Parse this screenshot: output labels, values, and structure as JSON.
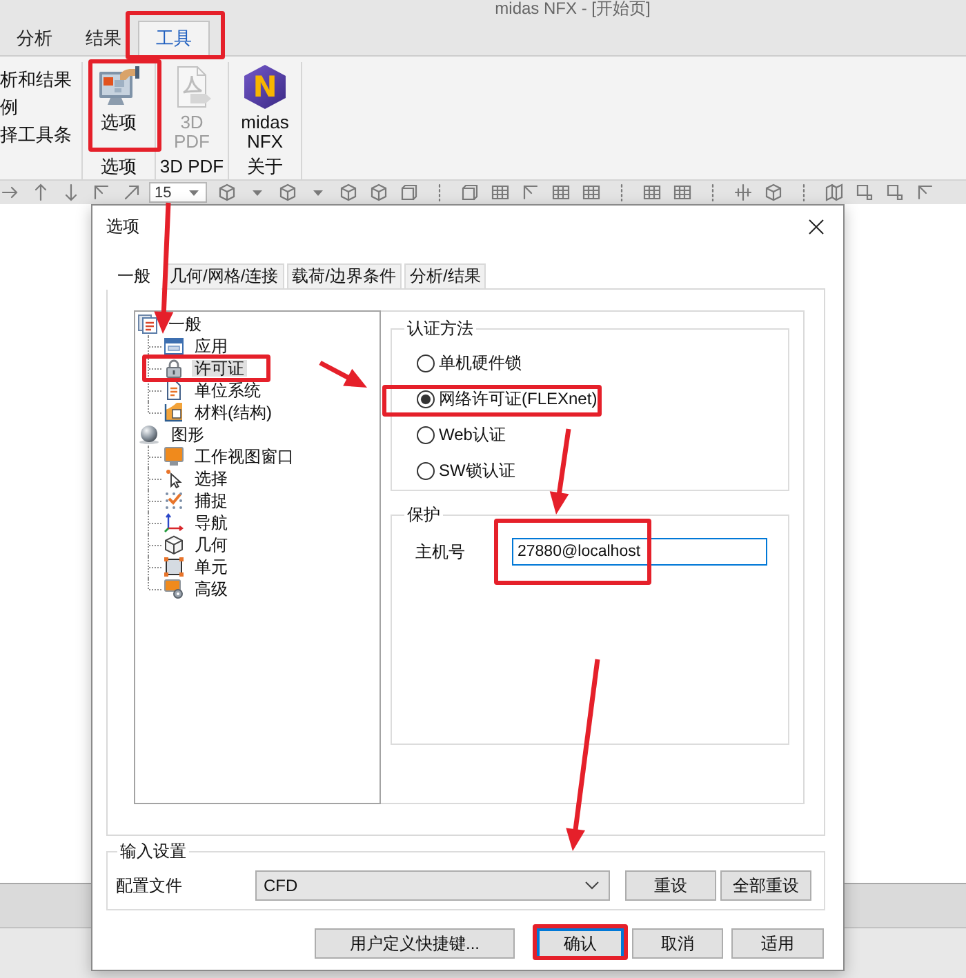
{
  "window": {
    "title": "midas NFX - [开始页]"
  },
  "ribbon": {
    "tabs": [
      {
        "label": "分析",
        "selected": false,
        "annotated": false
      },
      {
        "label": "结果",
        "selected": false,
        "annotated": false
      },
      {
        "label": "工具",
        "selected": true,
        "annotated": true
      }
    ],
    "cut_group": {
      "items": [
        "析和结果",
        "例",
        "择工具条"
      ]
    },
    "groups": [
      {
        "label": "选项",
        "buttons": [
          {
            "label": "选项",
            "disabled": false,
            "annotated": true
          }
        ]
      },
      {
        "label": "3D PDF",
        "buttons": [
          {
            "label": "3D PDF",
            "disabled": true,
            "annotated": false
          }
        ]
      },
      {
        "label": "关于",
        "buttons": [
          {
            "label": "midas NFX",
            "disabled": false,
            "annotated": false,
            "logo_letter": "N"
          }
        ]
      }
    ]
  },
  "toolbar": {
    "number_field": "15"
  },
  "dialog": {
    "title": "选项",
    "tabs": [
      {
        "label": "一般",
        "selected": true
      },
      {
        "label": "几何/网格/连接",
        "selected": false
      },
      {
        "label": "载荷/边界条件",
        "selected": false
      },
      {
        "label": "分析/结果",
        "selected": false
      }
    ],
    "tree": [
      {
        "label": "一般",
        "selected": false,
        "annotated": false,
        "children": [
          {
            "label": "应用",
            "selected": false,
            "annotated": false
          },
          {
            "label": "许可证",
            "selected": true,
            "annotated": true
          },
          {
            "label": "单位系统",
            "selected": false,
            "annotated": false
          },
          {
            "label": "材料(结构)",
            "selected": false,
            "annotated": false
          }
        ]
      },
      {
        "label": "图形",
        "selected": false,
        "annotated": false,
        "children": [
          {
            "label": "工作视图窗口",
            "selected": false,
            "annotated": false
          },
          {
            "label": "选择",
            "selected": false,
            "annotated": false
          },
          {
            "label": "捕捉",
            "selected": false,
            "annotated": false
          },
          {
            "label": "导航",
            "selected": false,
            "annotated": false
          },
          {
            "label": "几何",
            "selected": false,
            "annotated": false
          },
          {
            "label": "单元",
            "selected": false,
            "annotated": false
          },
          {
            "label": "高级",
            "selected": false,
            "annotated": false
          }
        ]
      }
    ],
    "auth_method": {
      "legend": "认证方法",
      "options": [
        {
          "label": "单机硬件锁",
          "selected": false,
          "annotated": false
        },
        {
          "label": "网络许可证(FLEXnet)",
          "selected": true,
          "annotated": true
        },
        {
          "label": "Web认证",
          "selected": false,
          "annotated": false
        },
        {
          "label": "SW锁认证",
          "selected": false,
          "annotated": false
        }
      ]
    },
    "protection": {
      "legend": "保护",
      "host": {
        "label": "主机号",
        "value": "27880@localhost",
        "annotated": true
      }
    },
    "input_settings": {
      "legend": "输入设置",
      "profile": {
        "label": "配置文件",
        "value": "CFD"
      },
      "buttons": [
        {
          "label": "重设"
        },
        {
          "label": "全部重设"
        }
      ]
    },
    "buttons": [
      {
        "label": "用户定义快捷键...",
        "default": false,
        "annotated": false
      },
      {
        "label": "确认",
        "default": true,
        "annotated": true
      },
      {
        "label": "取消",
        "default": false,
        "annotated": false
      },
      {
        "label": "适用",
        "default": false,
        "annotated": false
      }
    ]
  }
}
